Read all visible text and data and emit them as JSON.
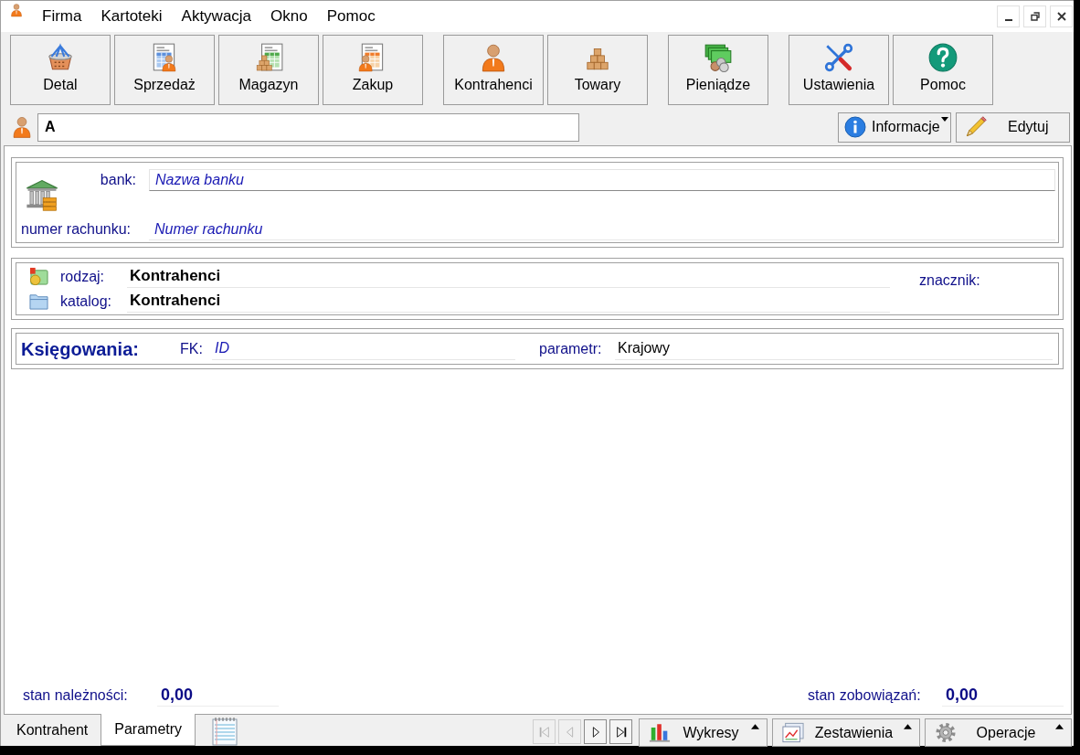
{
  "menu_bar": {
    "items": [
      {
        "label": "Firma"
      },
      {
        "label": "Kartoteki"
      },
      {
        "label": "Aktywacja"
      },
      {
        "label": "Okno"
      },
      {
        "label": "Pomoc"
      }
    ]
  },
  "toolbar": {
    "groups": [
      {
        "buttons": [
          {
            "label": "Detal"
          },
          {
            "label": "Sprzedaż"
          },
          {
            "label": "Magazyn"
          },
          {
            "label": "Zakup"
          }
        ]
      },
      {
        "buttons": [
          {
            "label": "Kontrahenci"
          },
          {
            "label": "Towary"
          }
        ]
      },
      {
        "buttons": [
          {
            "label": "Pieniądze"
          }
        ]
      },
      {
        "buttons": [
          {
            "label": "Ustawienia"
          },
          {
            "label": "Pomoc"
          }
        ]
      }
    ]
  },
  "contractor_bar": {
    "value": "A",
    "info_button": {
      "label": "Informacje"
    },
    "edit_button": {
      "label": "Edytuj"
    }
  },
  "bank_section": {
    "bank": {
      "label": "bank:",
      "placeholder": "Nazwa banku"
    },
    "account": {
      "label": "numer rachunku:",
      "placeholder": "Numer rachunku"
    }
  },
  "classification": {
    "rows": [
      {
        "label": "rodzaj:",
        "value": "Kontrahenci"
      },
      {
        "label": "katalog:",
        "value": "Kontrahenci"
      }
    ],
    "tag_label": "znacznik:"
  },
  "accounting": {
    "title": "Księgowania:",
    "fk": {
      "label": "FK:",
      "placeholder": "ID"
    },
    "parameter": {
      "label": "parametr:",
      "value": "Krajowy"
    }
  },
  "balances": [
    {
      "label": "stan należności:",
      "value": "0,00"
    },
    {
      "label": "stan zobowiązań:",
      "value": "0,00"
    }
  ],
  "tabs": [
    {
      "kind": "text",
      "label": "Kontrahent",
      "selected": false
    },
    {
      "kind": "text",
      "label": "Parametry",
      "selected": true
    },
    {
      "kind": "icon",
      "selected": false
    }
  ],
  "record_navigator": {
    "buttons": [
      {
        "disabled": true
      },
      {
        "disabled": true
      },
      {
        "disabled": false
      },
      {
        "disabled": false
      }
    ]
  },
  "action_buttons": [
    {
      "label": "Wykresy"
    },
    {
      "label": "Zestawienia"
    },
    {
      "label": "Operacje"
    }
  ]
}
